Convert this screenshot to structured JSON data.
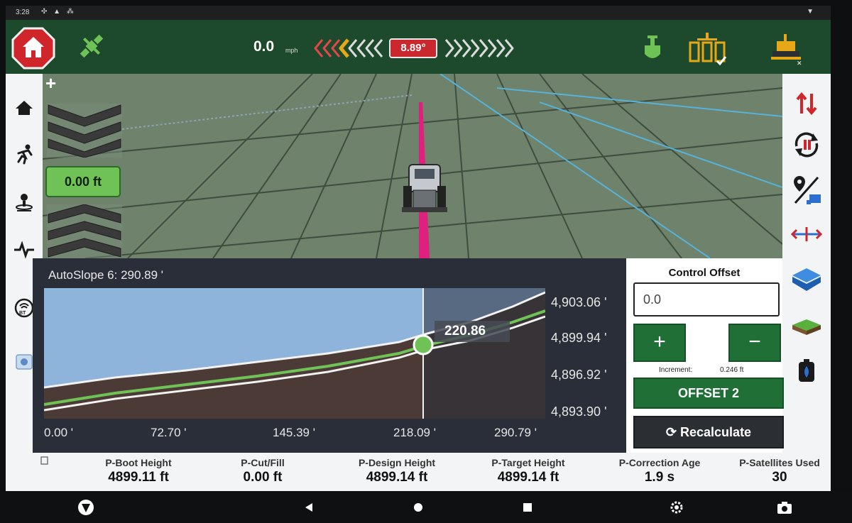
{
  "statusbar": {
    "time": "3:28",
    "icons": "✣ ▲ ⁂"
  },
  "toolbar": {
    "speed": "0.0",
    "speed_unit": "mph",
    "angle": "8.89°",
    "colors": {
      "bar": "#1d4a2c",
      "home": "#d0262b",
      "accent": "#e6a817",
      "alert": "#c8282e"
    }
  },
  "view3d": {
    "zoom_plus": "+",
    "elevation_offset": "0.00 ft"
  },
  "profile": {
    "title": "AutoSlope 6: 290.89 '",
    "cursor_label": "220.86",
    "y_ticks": [
      "4,903.06 '",
      "4,899.94 '",
      "4,896.92 '",
      "4,893.90 '"
    ],
    "x_ticks": [
      "0.00 '",
      "72.70 '",
      "145.39 '",
      "218.09 '",
      "290.79 '"
    ]
  },
  "control_offset": {
    "title": "Control Offset",
    "input_value": "0.0",
    "plus": "+",
    "minus": "−",
    "increment_label": "Increment:",
    "increment_value": "0.246 ft",
    "offset_button": "OFFSET 2",
    "recalculate_button": "Recalculate"
  },
  "readouts": [
    {
      "label": "P-Boot Height",
      "value": "4899.11 ft"
    },
    {
      "label": "P-Cut/Fill",
      "value": "0.00 ft"
    },
    {
      "label": "P-Design Height",
      "value": "4899.14 ft"
    },
    {
      "label": "P-Target Height",
      "value": "4899.14 ft"
    },
    {
      "label": "P-Correction Age",
      "value": "1.9 s"
    },
    {
      "label": "P-Satellites Used",
      "value": "30"
    }
  ],
  "icons": {
    "left": [
      "home-icon",
      "run-icon",
      "anchor-point-icon",
      "pulse-icon",
      "gnss-receiver-icon",
      "app-icon"
    ],
    "right": [
      "swap-icon",
      "rotate-icon",
      "pin-machine-icon",
      "crosshair-icon",
      "layers-icon",
      "surface-icon",
      "battery-icon"
    ],
    "nav": [
      "brand-logo-icon",
      "back-icon",
      "home-nav-icon",
      "recents-icon",
      "settings-gear-icon",
      "camera-icon"
    ]
  }
}
